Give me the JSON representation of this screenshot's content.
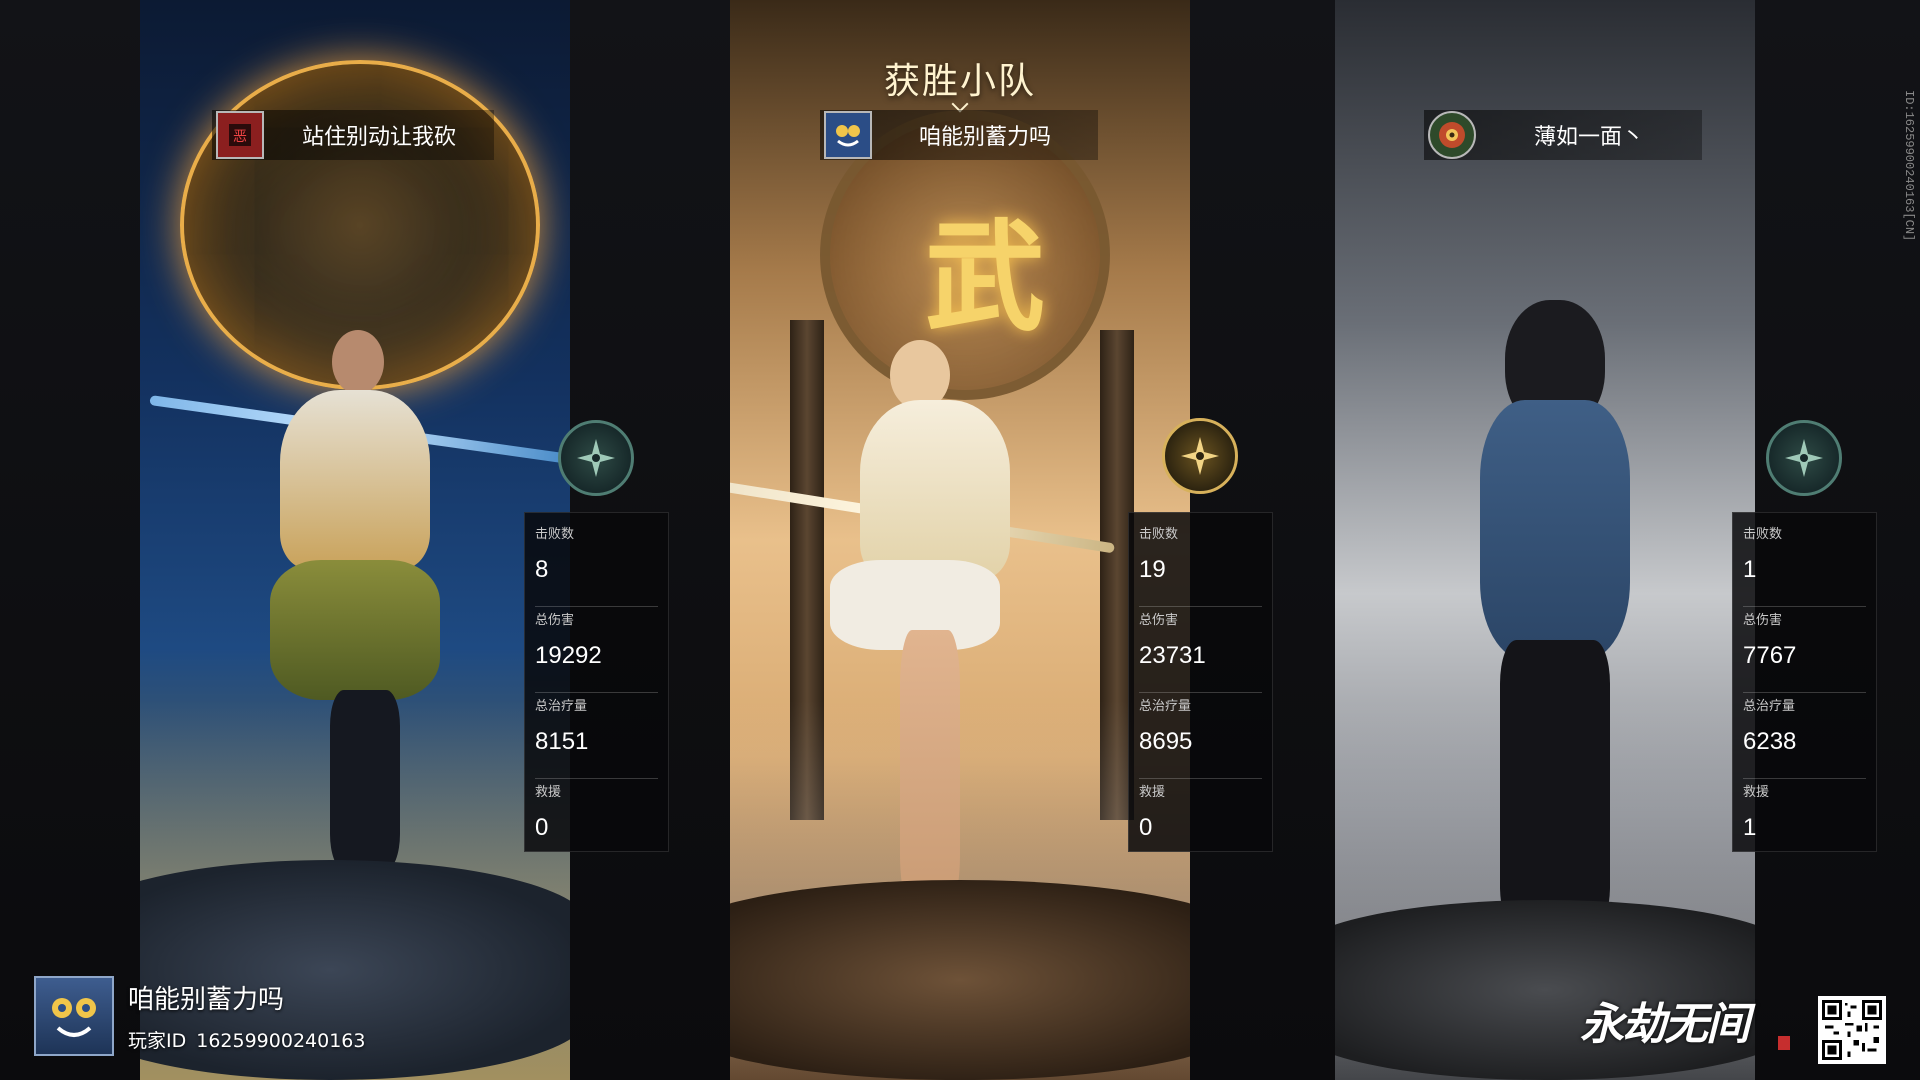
{
  "winner_title": "获胜小队",
  "players": [
    {
      "team_name": "站住别动让我砍",
      "team_emblem_icon": "red-seal-emblem-icon",
      "class_icon": "teal-shuriken-icon",
      "stats": [
        {
          "label": "击败数",
          "value": "8"
        },
        {
          "label": "总伤害",
          "value": "19292"
        },
        {
          "label": "总治疗量",
          "value": "8151"
        },
        {
          "label": "救援",
          "value": "0"
        }
      ]
    },
    {
      "team_name": "咱能别蓄力吗",
      "team_emblem_icon": "blue-mask-emblem-icon",
      "class_icon": "gold-shuriken-icon",
      "stats": [
        {
          "label": "击败数",
          "value": "19"
        },
        {
          "label": "总伤害",
          "value": "23731"
        },
        {
          "label": "总治疗量",
          "value": "8695"
        },
        {
          "label": "救援",
          "value": "0"
        }
      ]
    },
    {
      "team_name": "薄如一面丶",
      "team_emblem_icon": "flower-emblem-icon",
      "class_icon": "teal-shuriken-icon",
      "stats": [
        {
          "label": "击败数",
          "value": "1"
        },
        {
          "label": "总伤害",
          "value": "7767"
        },
        {
          "label": "总治疗量",
          "value": "6238"
        },
        {
          "label": "救援",
          "value": "1"
        }
      ]
    }
  ],
  "current_player": {
    "name": "咱能别蓄力吗",
    "id_label": "玩家ID",
    "id": "16259900240163"
  },
  "vertical_id": "ID:16259900240163[CN]",
  "game_logo": "永劫无间",
  "decor_glyph": "武",
  "colors": {
    "teal_emblem": "#4f7d73",
    "gold_emblem": "#d7b15b",
    "stats_panel": "#08080a"
  }
}
